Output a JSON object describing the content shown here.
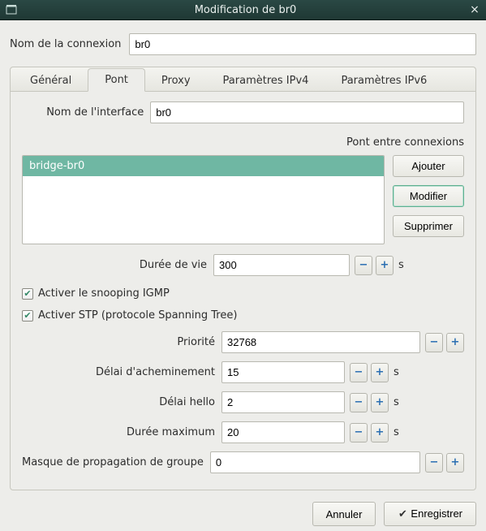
{
  "title": "Modification de br0",
  "connection_name_label": "Nom de la connexion",
  "connection_name_value": "br0",
  "tabs": {
    "general": "Général",
    "pont": "Pont",
    "proxy": "Proxy",
    "ipv4": "Paramètres IPv4",
    "ipv6": "Paramètres IPv6"
  },
  "pont": {
    "interface_name_label": "Nom de l'interface",
    "interface_name_value": "br0",
    "bridged_conn_label": "Pont entre connexions",
    "list": {
      "item0": "bridge-br0"
    },
    "buttons": {
      "add": "Ajouter",
      "edit": "Modifier",
      "delete": "Supprimer"
    },
    "aging_label": "Durée de vie",
    "aging_value": "300",
    "seconds": "s",
    "igmp_label": "Activer le snooping IGMP",
    "stp_label": "Activer STP (protocole Spanning Tree)",
    "priority_label": "Priorité",
    "priority_value": "32768",
    "forward_delay_label": "Délai d'acheminement",
    "forward_delay_value": "15",
    "hello_label": "Délai hello",
    "hello_value": "2",
    "max_age_label": "Durée maximum",
    "max_age_value": "20",
    "group_mask_label": "Masque de propagation de groupe",
    "group_mask_value": "0"
  },
  "actions": {
    "cancel": "Annuler",
    "save": "Enregistrer"
  }
}
